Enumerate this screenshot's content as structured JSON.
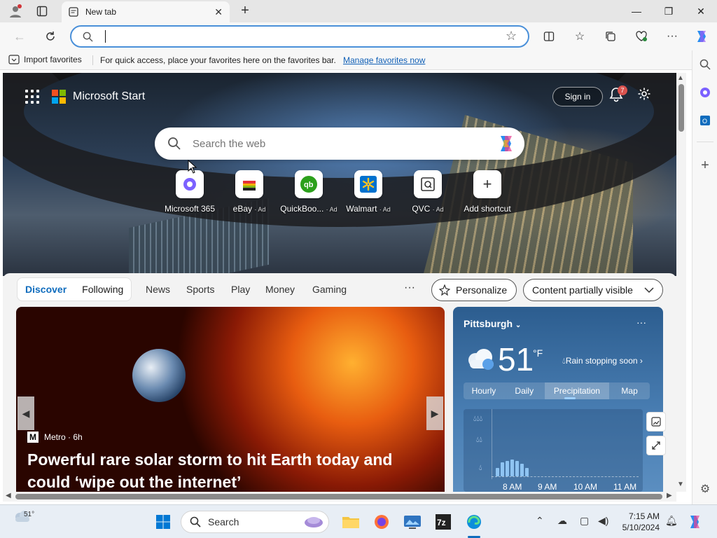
{
  "browser": {
    "tab_title": "New tab",
    "address_value": "",
    "favorites_bar": {
      "import_label": "Import favorites",
      "hint": "For quick access, place your favorites here on the favorites bar.",
      "manage_link": "Manage favorites now"
    }
  },
  "start": {
    "brand": "Microsoft Start",
    "sign_in": "Sign in",
    "notifications_count": "7",
    "search_placeholder": "Search the web",
    "shortcuts": [
      {
        "label": "Microsoft 365",
        "ad": ""
      },
      {
        "label": "eBay",
        "ad": "· Ad"
      },
      {
        "label": "QuickBoo...",
        "ad": "· Ad"
      },
      {
        "label": "Walmart",
        "ad": "· Ad"
      },
      {
        "label": "QVC",
        "ad": "· Ad"
      },
      {
        "label": "Add shortcut",
        "ad": ""
      }
    ],
    "feed_tabs": {
      "discover": "Discover",
      "following": "Following"
    },
    "categories": [
      "News",
      "Sports",
      "Play",
      "Money",
      "Gaming"
    ],
    "more": "···",
    "personalize": "Personalize",
    "visibility": "Content partially visible",
    "news": {
      "source": "Metro · 6h",
      "title": "Powerful rare solar storm to hit Earth today and could ‘wipe out the internet’"
    },
    "weather": {
      "city": "Pittsburgh",
      "temp": "51",
      "unit": "°F",
      "condition": "Rain stopping soon",
      "tabs": [
        "Hourly",
        "Daily",
        "Precipitation",
        "Map"
      ],
      "times": [
        "8 AM",
        "9 AM",
        "10 AM",
        "11 AM"
      ],
      "precip_levels": [
        0.3,
        0.5,
        0.55,
        0.6,
        0.55,
        0.45,
        0.3
      ]
    }
  },
  "taskbar": {
    "weather_temp": "51°",
    "search_label": "Search",
    "time": "7:15 AM",
    "date": "5/10/2024"
  },
  "colors": {
    "accent": "#0f6cbd",
    "badge": "#d9534f",
    "weather_top": "#2c5d8f"
  }
}
